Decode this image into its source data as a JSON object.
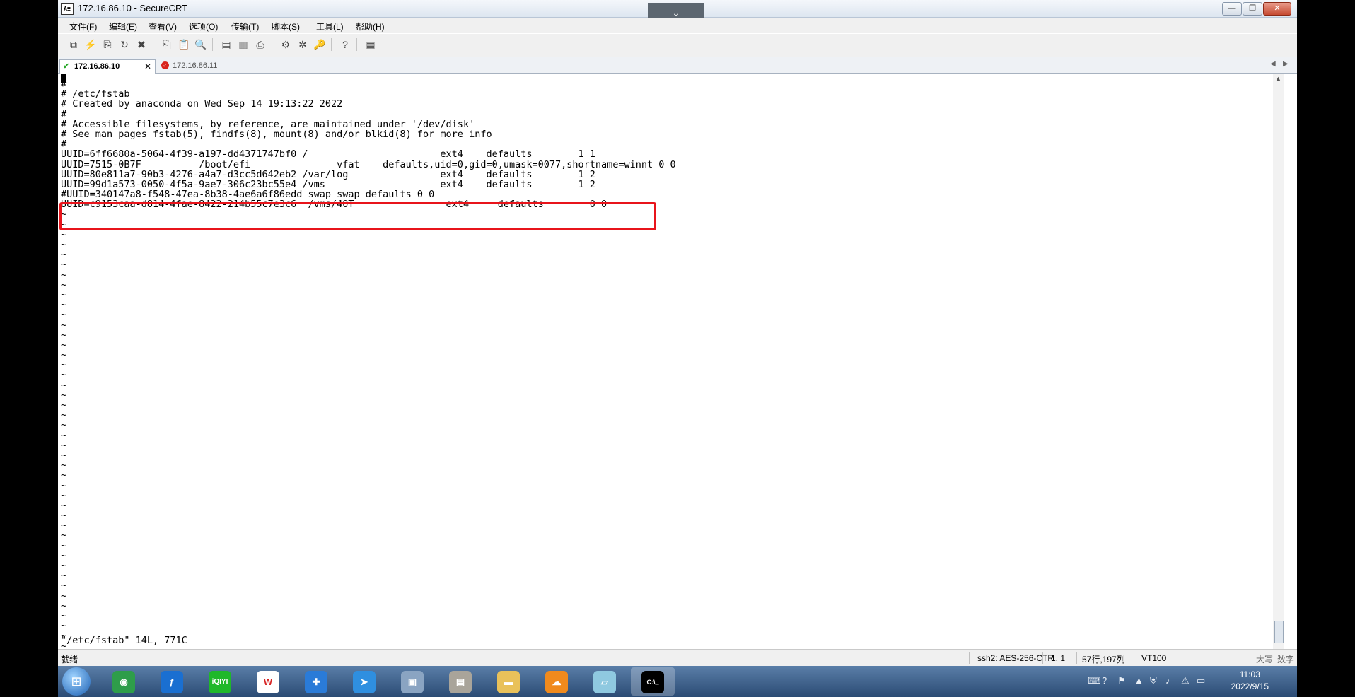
{
  "window": {
    "title": "172.16.86.10 - SecureCRT",
    "app_icon": "securecrt-icon"
  },
  "menu": [
    "文件(F)",
    "编辑(E)",
    "查看(V)",
    "选项(O)",
    "传输(T)",
    "脚本(S)",
    "工具(L)",
    "帮助(H)"
  ],
  "tabs": {
    "active": "172.16.86.10",
    "inactive": "172.16.86.11"
  },
  "terminal": {
    "lines": [
      "#",
      "# /etc/fstab",
      "# Created by anaconda on Wed Sep 14 19:13:22 2022",
      "#",
      "# Accessible filesystems, by reference, are maintained under '/dev/disk'",
      "# See man pages fstab(5), findfs(8), mount(8) and/or blkid(8) for more info",
      "#",
      "UUID=6ff6680a-5064-4f39-a197-dd4371747bf0 /                       ext4    defaults        1 1",
      "UUID=7515-0B7F          /boot/efi               vfat    defaults,uid=0,gid=0,umask=0077,shortname=winnt 0 0",
      "UUID=80e811a7-90b3-4276-a4a7-d3cc5d642eb2 /var/log                ext4    defaults        1 2",
      "UUID=99d1a573-0050-4f5a-9ae7-306c23bc55e4 /vms                    ext4    defaults        1 2",
      "#UUID=340147a8-f548-47ea-8b38-4ae6a6f86edd swap swap defaults 0 0",
      "UUID=c9153caa-d814-4fae-8422-214b55c7e3c6  /vms/40T                ext4     defaults        0 0",
      "~",
      "~",
      "~",
      "~",
      "~",
      "~",
      "~",
      "~",
      "~",
      "~",
      "~",
      "~",
      "~",
      "~",
      "~",
      "~",
      "~",
      "~",
      "~",
      "~",
      "~",
      "~",
      "~",
      "~",
      "~",
      "~",
      "~",
      "~",
      "~",
      "~",
      "~",
      "~",
      "~",
      "~",
      "~",
      "~",
      "~",
      "~",
      "~",
      "~",
      "~",
      "~",
      "~",
      "~"
    ],
    "status_message": "\"/etc/fstab\" 14L, 771C"
  },
  "statusbar": {
    "ready": "就绪",
    "encryption": "ssh2: AES-256-CTR",
    "position": "1,  1",
    "size": "57行,197列",
    "emulation": "VT100",
    "caps": "大写",
    "num": "数字"
  },
  "taskbar": {
    "apps": [
      "start",
      "browser",
      "flash",
      "iQIYI",
      "wps",
      "app",
      "mail",
      "network",
      "app2",
      "explorer",
      "uc",
      "notes",
      "terminal"
    ],
    "clock_time": "11:03",
    "clock_date": "2022/9/15"
  },
  "colors": {
    "highlight": "#e8141b"
  }
}
